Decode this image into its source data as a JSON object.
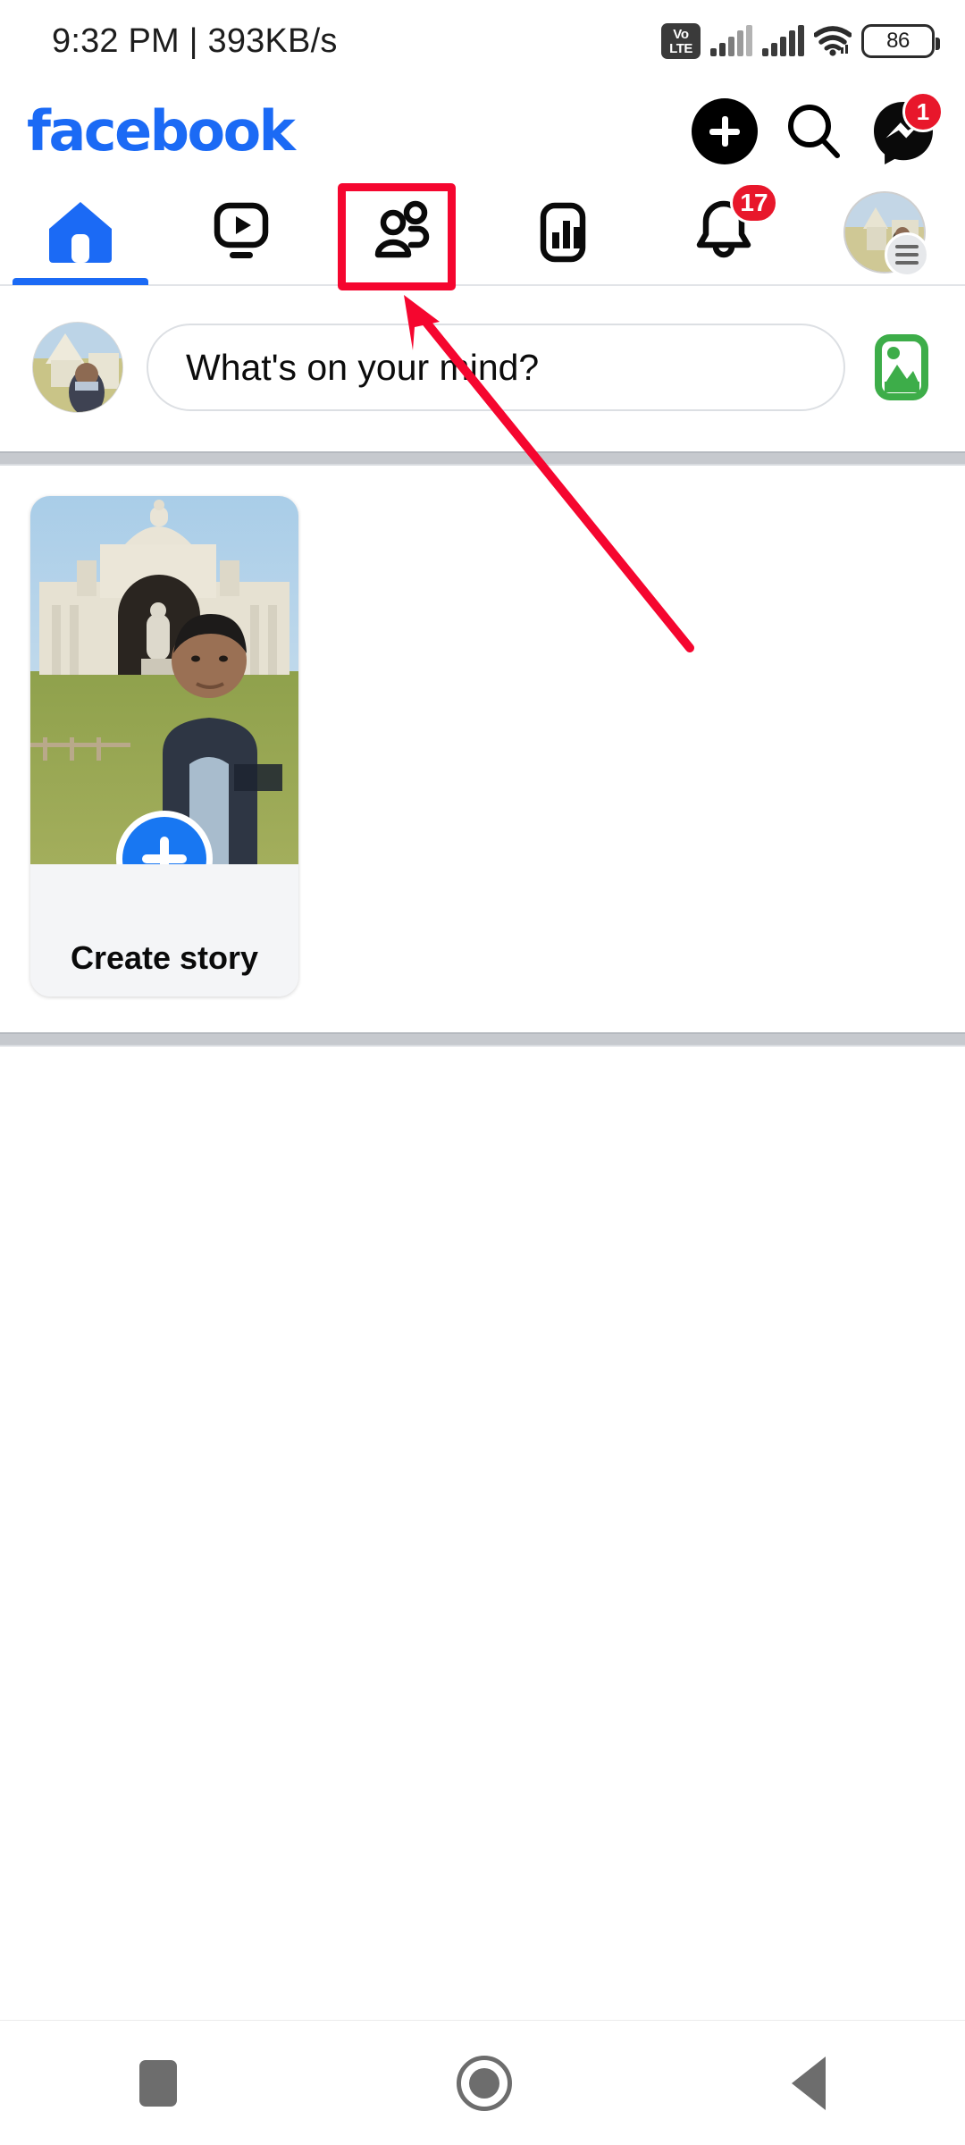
{
  "statusbar": {
    "time_and_network": "9:32 PM | 393KB/s",
    "volte_top": "Vo",
    "volte_bottom": "LTE",
    "battery_level": "86",
    "icons": [
      "volte-icon",
      "signal-bars-icon",
      "signal-bars-icon",
      "wifi-icon",
      "battery-icon"
    ]
  },
  "header": {
    "logo_text": "facebook",
    "logo_color": "#1b6af5",
    "create_label": "+",
    "search_icon": "search-icon",
    "messenger_icon": "messenger-icon",
    "messenger_badge": "1",
    "badge_color": "#e8172b"
  },
  "nav_tabs": [
    {
      "name": "home",
      "icon": "home-icon",
      "active": true,
      "badge": ""
    },
    {
      "name": "video",
      "icon": "video-play-icon",
      "active": false,
      "badge": ""
    },
    {
      "name": "friends",
      "icon": "friends-people-icon",
      "active": false,
      "badge": ""
    },
    {
      "name": "marketplace",
      "icon": "bar-chart-icon",
      "active": false,
      "badge": ""
    },
    {
      "name": "notifications",
      "icon": "bell-icon",
      "active": false,
      "badge": "17"
    },
    {
      "name": "menu",
      "icon": "profile-avatar-menu-icon",
      "active": false,
      "badge": ""
    }
  ],
  "composer": {
    "placeholder": "What's on your mind?",
    "avatar": "user-avatar",
    "photo_icon": "photo-gallery-icon",
    "photo_icon_color": "#3dad49"
  },
  "stories": {
    "cards": [
      {
        "label": "Create story",
        "action_icon": "plus-icon",
        "thumbnail": "user-at-monument-photo"
      }
    ]
  },
  "android_nav": {
    "recents_label": "recents-button",
    "home_label": "home-button",
    "back_label": "back-button"
  },
  "annotations": {
    "highlight_color": "#f5062f",
    "highlight_target": "friends-tab",
    "arrow_points_to": "friends-tab"
  }
}
